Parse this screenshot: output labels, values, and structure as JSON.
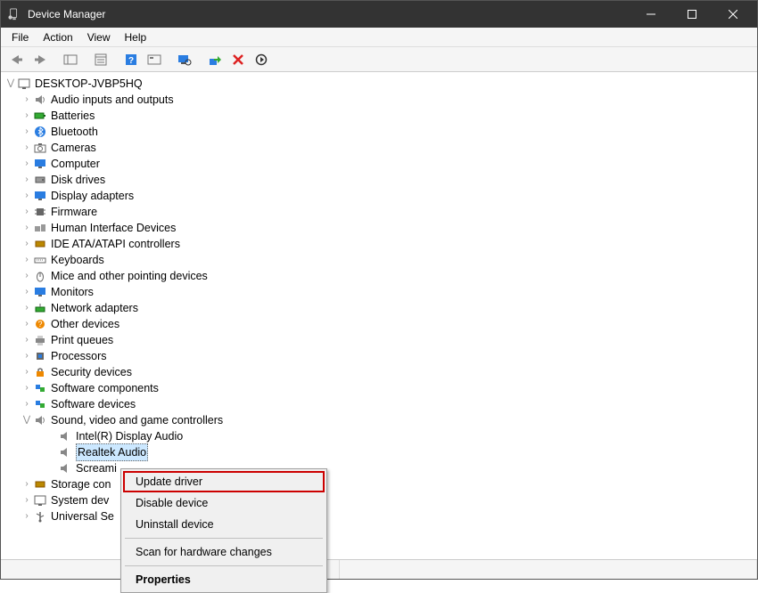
{
  "window": {
    "title": "Device Manager"
  },
  "menus": {
    "file": "File",
    "action": "Action",
    "view": "View",
    "help": "Help"
  },
  "tree": {
    "root": {
      "label": "DESKTOP-JVBP5HQ"
    },
    "categories": [
      {
        "label": "Audio inputs and outputs"
      },
      {
        "label": "Batteries"
      },
      {
        "label": "Bluetooth"
      },
      {
        "label": "Cameras"
      },
      {
        "label": "Computer"
      },
      {
        "label": "Disk drives"
      },
      {
        "label": "Display adapters"
      },
      {
        "label": "Firmware"
      },
      {
        "label": "Human Interface Devices"
      },
      {
        "label": "IDE ATA/ATAPI controllers"
      },
      {
        "label": "Keyboards"
      },
      {
        "label": "Mice and other pointing devices"
      },
      {
        "label": "Monitors"
      },
      {
        "label": "Network adapters"
      },
      {
        "label": "Other devices"
      },
      {
        "label": "Print queues"
      },
      {
        "label": "Processors"
      },
      {
        "label": "Security devices"
      },
      {
        "label": "Software components"
      },
      {
        "label": "Software devices"
      },
      {
        "label": "Sound, video and game controllers"
      },
      {
        "label": "Storage con"
      },
      {
        "label": "System dev"
      },
      {
        "label": "Universal Se"
      }
    ],
    "sound_children": [
      {
        "label": "Intel(R) Display Audio"
      },
      {
        "label": "Realtek Audio"
      },
      {
        "label": "Screami"
      }
    ]
  },
  "context_menu": {
    "update": "Update driver",
    "disable": "Disable device",
    "uninstall": "Uninstall device",
    "scan": "Scan for hardware changes",
    "properties": "Properties"
  }
}
